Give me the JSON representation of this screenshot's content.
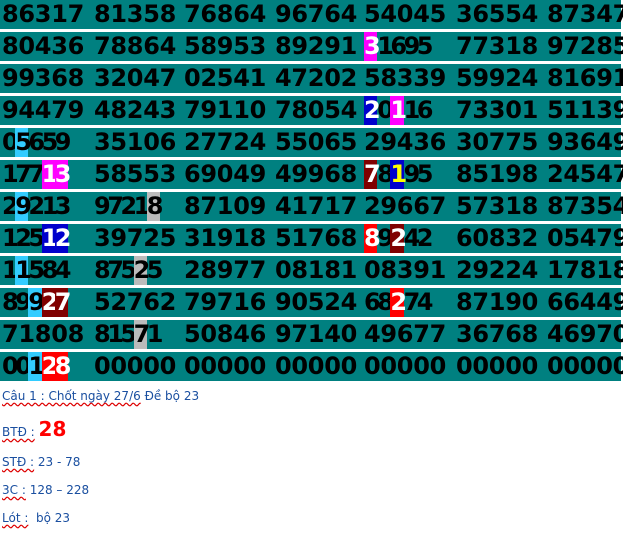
{
  "colors": {
    "teal": "#008080",
    "cyan": "#33ccff",
    "magenta": "#ff00ff",
    "blue": "#0000cc",
    "red": "#ff0000",
    "darkred": "#800000",
    "gray": "#bbbbbb",
    "yellow": "#ffff00"
  },
  "rows": [
    [
      "86317",
      "81358",
      "76864",
      "96764",
      "54045",
      "36554",
      "87347"
    ],
    [
      "80436",
      "78864",
      "58953",
      "89291",
      "31695",
      "77318",
      "97285"
    ],
    [
      "99368",
      "32047",
      "02541",
      "47202",
      "58339",
      "59924",
      "81691"
    ],
    [
      "94479",
      "48243",
      "79110",
      "78054",
      "20116",
      "73301",
      "51139"
    ],
    [
      "05659",
      "35106",
      "27724",
      "55065",
      "29436",
      "30775",
      "93649"
    ],
    [
      "17713",
      "58553",
      "69049",
      "49968",
      "78195",
      "85198",
      "24547"
    ],
    [
      "29213",
      "97218",
      "87109",
      "41717",
      "29667",
      "57318",
      "87354"
    ],
    [
      "12512",
      "39725",
      "31918",
      "51768",
      "89242",
      "60832",
      "05479"
    ],
    [
      "11584",
      "87525",
      "28977",
      "08181",
      "08391",
      "29224",
      "17818"
    ],
    [
      "89927",
      "52762",
      "79716",
      "90524",
      "68274",
      "87190",
      "66449"
    ],
    [
      "71808",
      "81571",
      "50846",
      "97140",
      "49677",
      "36768",
      "46970"
    ],
    [
      "00128",
      "00000",
      "00000",
      "00000",
      "00000",
      "00000",
      "00000"
    ]
  ],
  "highlights": [
    {
      "row": 1,
      "col": 4,
      "chars": [
        0
      ],
      "bg": "magenta",
      "fg": "white"
    },
    {
      "row": 3,
      "col": 4,
      "chars": [
        0
      ],
      "bg": "blue",
      "fg": "white"
    },
    {
      "row": 3,
      "col": 4,
      "chars": [
        2
      ],
      "bg": "magenta",
      "fg": "white"
    },
    {
      "row": 4,
      "col": 0,
      "chars": [
        1
      ],
      "bg": "cyan",
      "fg": "black"
    },
    {
      "row": 5,
      "col": 0,
      "chars": [
        3,
        4
      ],
      "bg": "magenta",
      "fg": "white"
    },
    {
      "row": 5,
      "col": 4,
      "chars": [
        0
      ],
      "bg": "darkred",
      "fg": "white"
    },
    {
      "row": 5,
      "col": 4,
      "chars": [
        2
      ],
      "bg": "blue",
      "fg": "yellow"
    },
    {
      "row": 6,
      "col": 0,
      "chars": [
        1
      ],
      "bg": "cyan",
      "fg": "black"
    },
    {
      "row": 6,
      "col": 1,
      "chars": [
        4
      ],
      "bg": "gray",
      "fg": "black"
    },
    {
      "row": 7,
      "col": 0,
      "chars": [
        3,
        4
      ],
      "bg": "blue",
      "fg": "white"
    },
    {
      "row": 7,
      "col": 4,
      "chars": [
        0
      ],
      "bg": "red",
      "fg": "white"
    },
    {
      "row": 7,
      "col": 4,
      "chars": [
        2
      ],
      "bg": "darkred",
      "fg": "white"
    },
    {
      "row": 8,
      "col": 0,
      "chars": [
        1
      ],
      "bg": "cyan",
      "fg": "black"
    },
    {
      "row": 8,
      "col": 1,
      "chars": [
        3
      ],
      "bg": "gray",
      "fg": "black"
    },
    {
      "row": 9,
      "col": 0,
      "chars": [
        2
      ],
      "bg": "cyan",
      "fg": "black"
    },
    {
      "row": 9,
      "col": 0,
      "chars": [
        3,
        4
      ],
      "bg": "darkred",
      "fg": "white"
    },
    {
      "row": 9,
      "col": 4,
      "chars": [
        2
      ],
      "bg": "red",
      "fg": "white"
    },
    {
      "row": 10,
      "col": 1,
      "chars": [
        3
      ],
      "bg": "gray",
      "fg": "black"
    },
    {
      "row": 11,
      "col": 0,
      "chars": [
        2
      ],
      "bg": "cyan",
      "fg": "black"
    },
    {
      "row": 11,
      "col": 0,
      "chars": [
        3,
        4
      ],
      "bg": "red",
      "fg": "white"
    }
  ],
  "info": {
    "line1_label": "Câu 1 : Chốt ngày 27/6",
    "line1_value": " Đề bộ 23",
    "btd_label": "BTĐ :",
    "btd_value": "28",
    "std_label": "STĐ :",
    "std_value": " 23 - 78",
    "c3_label": "3C :",
    "c3_value": " 128 – 228",
    "lot_label": "Lót :",
    "lot_value": "  bộ 23"
  }
}
